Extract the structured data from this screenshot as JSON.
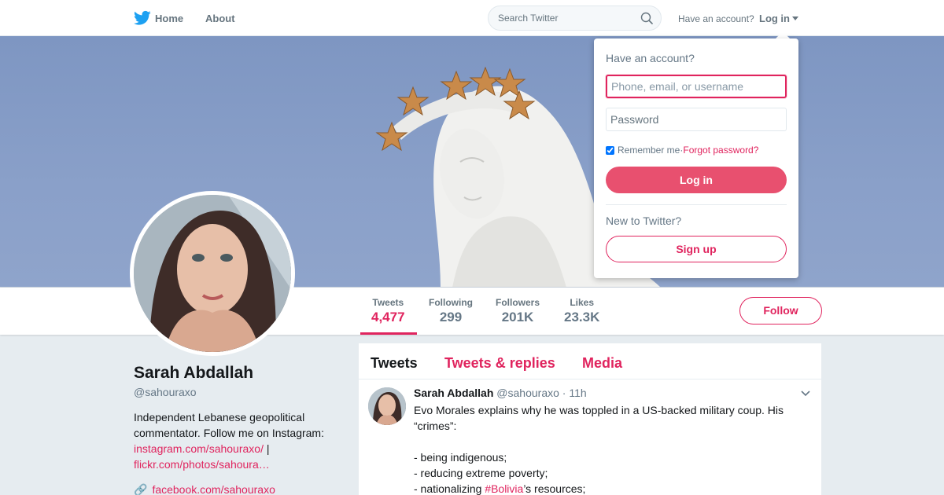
{
  "nav": {
    "home_label": "Home",
    "about_label": "About",
    "search_placeholder": "Search Twitter",
    "have_account": "Have an account?",
    "login_label": "Log in",
    "logo_icon": "twitter-bird-icon",
    "accent_color": "#1da1f2"
  },
  "profile": {
    "name": "Sarah Abdallah",
    "handle": "@sahouraxo",
    "bio_text": "Independent Lebanese geopolitical commentator. Follow me on Instagram:",
    "bio_link1": "instagram.com/sahouraxo/",
    "bio_sep": " |",
    "bio_link2": "flickr.com/photos/sahoura…",
    "website": "facebook.com/sahouraxo",
    "website_icon": "link-icon"
  },
  "stats": [
    {
      "label": "Tweets",
      "value": "4,477"
    },
    {
      "label": "Following",
      "value": "299"
    },
    {
      "label": "Followers",
      "value": "201K"
    },
    {
      "label": "Likes",
      "value": "23.3K"
    }
  ],
  "follow_label": "Follow",
  "tabs": [
    {
      "label": "Tweets"
    },
    {
      "label": "Tweets & replies"
    },
    {
      "label": "Media"
    }
  ],
  "tweet": {
    "name": "Sarah Abdallah",
    "handle": "@sahouraxo",
    "dot": "·",
    "time": "11h",
    "line1": "Evo Morales explains why he was toppled in a US-backed military coup. His “crimes”:",
    "line2": "- being indigenous;",
    "line3": "- reducing extreme poverty;",
    "line4_pre": "- nationalizing ",
    "line4_tag": "#Bolivia",
    "line4_post": "’s resources;"
  },
  "login_dropdown": {
    "title": "Have an account?",
    "username_placeholder": "Phone, email, or username",
    "password_placeholder": "Password",
    "remember_label": "Remember me",
    "separator": " · ",
    "forgot_label": "Forgot password?",
    "login_button": "Log in",
    "new_label": "New to Twitter?",
    "signup_button": "Sign up"
  },
  "colors": {
    "brand_accent": "#e0245e",
    "login_button": "#e8506f",
    "banner_sky": "#8aa0c9",
    "background": "#e6ecf0"
  }
}
